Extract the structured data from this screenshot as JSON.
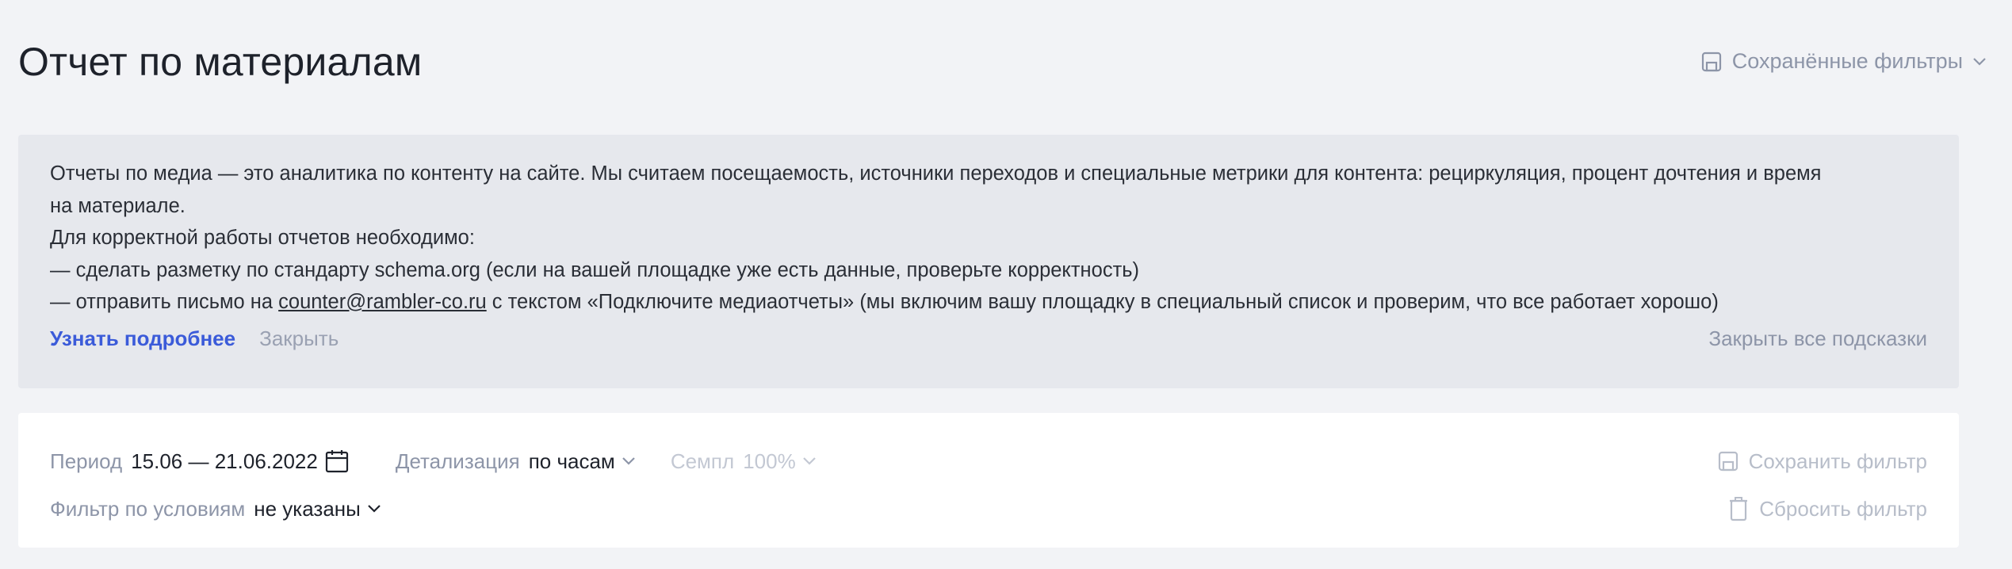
{
  "header": {
    "title": "Отчет по материалам",
    "saved_filters_label": "Сохранённые фильтры"
  },
  "hint": {
    "line1": "Отчеты по медиа — это аналитика по контенту на сайте. Мы считаем посещаемость, источники переходов и специальные метрики для контента: рециркуляция, процент дочтения и время",
    "line2": "на материале.",
    "line3": "Для корректной работы отчетов необходимо:",
    "line4": "— сделать разметку по стандарту schema.org (если на вашей площадке уже есть данные, проверьте корректность)",
    "line5_prefix": "— отправить письмо на ",
    "line5_email": "counter@rambler-co.ru",
    "line5_suffix": " с текстом «Подключите медиаотчеты» (мы включим вашу площадку в специальный список и проверим, что все работает хорошо)",
    "learn_more": "Узнать подробнее",
    "close": "Закрыть",
    "close_all": "Закрыть все подсказки"
  },
  "filters": {
    "period_label": "Период",
    "period_value": "15.06 — 21.06.2022",
    "detail_label": "Детализация",
    "detail_value": "по часам",
    "sample_label": "Семпл",
    "sample_value": "100%",
    "condition_label": "Фильтр по условиям",
    "condition_value": "не указаны",
    "save_filter": "Сохранить фильтр",
    "reset_filter": "Сбросить фильтр"
  },
  "icons": {
    "saved_filters": "floppy-disk-icon",
    "calendar": "calendar-icon",
    "chevron": "chevron-down-icon",
    "trash": "trash-icon"
  },
  "colors": {
    "background": "#f2f3f6",
    "hint_background": "#e6e8ed",
    "link": "#3b5bd9",
    "muted": "#8d95a8",
    "disabled": "#c3c8d3"
  }
}
